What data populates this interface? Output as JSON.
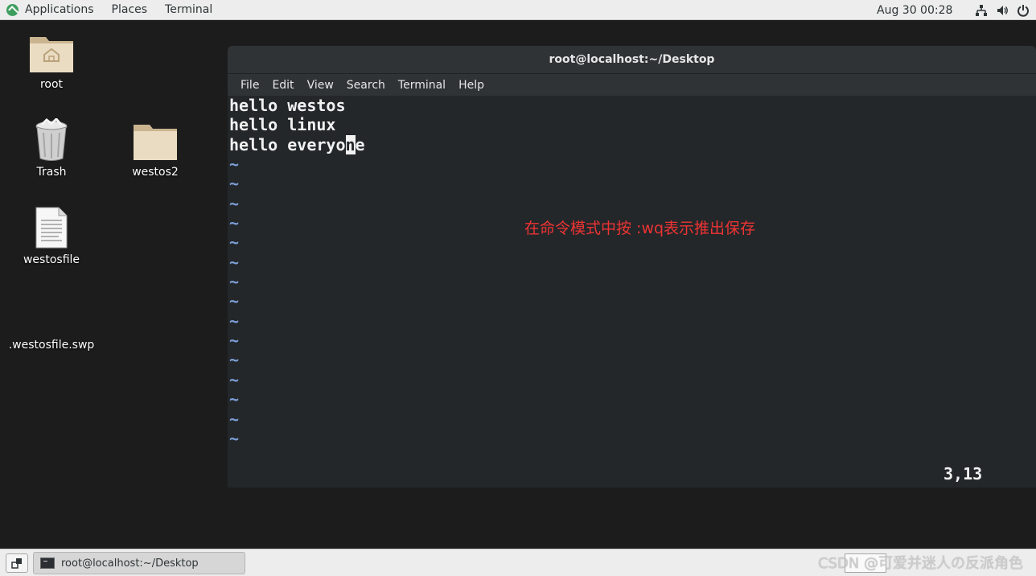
{
  "topbar": {
    "applications": "Applications",
    "places": "Places",
    "terminal": "Terminal",
    "clock": "Aug 30  00:28",
    "icons": [
      "network-icon",
      "volume-icon",
      "power-icon"
    ]
  },
  "desktop": {
    "icons": [
      {
        "label": "root",
        "icon": "home-folder-icon"
      },
      {
        "label": "Trash",
        "icon": "trash-icon"
      },
      {
        "label": "westos2",
        "icon": "folder-icon"
      },
      {
        "label": "westosfile",
        "icon": "text-file-icon"
      },
      {
        "label": ".westosfile.swp",
        "icon": "hidden-file"
      }
    ]
  },
  "terminal": {
    "title": "root@localhost:~/Desktop",
    "menu": [
      "File",
      "Edit",
      "View",
      "Search",
      "Terminal",
      "Help"
    ],
    "lines": [
      "hello westos",
      "hello linux"
    ],
    "line3_before": "hello everyo",
    "line3_cursor": "n",
    "line3_after": "e",
    "tilde": "~",
    "cursor_position": "3,13",
    "annotation": "在命令模式中按 :wq表示推出保存"
  },
  "taskbar": {
    "window_title": "root@localhost:~/Desktop",
    "watermark": "CSDN @可爱并迷人の反派角色"
  },
  "colors": {
    "terminal_bg": "#23272a",
    "tilde": "#7c9ed6",
    "annotation": "#ee3333"
  }
}
